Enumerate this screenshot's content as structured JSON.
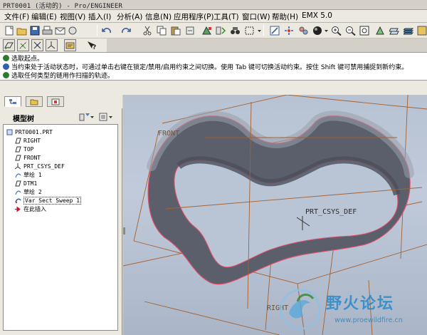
{
  "window": {
    "title": "PRT0001 (活动的) - Pro/ENGINEER"
  },
  "menu": [
    "文件(F)",
    "编辑(E)",
    "视图(V)",
    "插入(I)",
    "分析(A)",
    "信息(N)",
    "应用程序(P)",
    "工具(T)",
    "窗口(W)",
    "帮助(H)",
    "EMX 5.0"
  ],
  "toolbar": {
    "icons": [
      "new-icon",
      "open-icon",
      "save-icon",
      "print-icon",
      "email-icon",
      "undo-icon",
      "redo-icon",
      "cut-icon",
      "copy-icon",
      "paste-icon",
      "regenerate-icon",
      "find-icon",
      "select-box-icon",
      "repaint-icon",
      "spin-center-icon",
      "view-manager-icon",
      "shading-icon",
      "zoom-in-icon",
      "zoom-out-icon",
      "refit-icon",
      "orient-icon",
      "saved-views-icon",
      "layers-icon"
    ],
    "row2_icons": [
      "datum-plane-display-icon",
      "datum-axis-display-icon",
      "point-display-icon",
      "csys-display-icon",
      "annotation-display-icon",
      "context-help-icon"
    ]
  },
  "messages": [
    {
      "icon": "prompt",
      "text": "选取起点。"
    },
    {
      "icon": "info",
      "text": "当约束处于活动状态时，可通过单击右键在锁定/禁用/启用约束之间切换。使用 Tab 键可切换活动约束。按住 Shift 键可禁用捕捉到新约束。"
    },
    {
      "icon": "prompt",
      "text": "选取任何类型的链用作扫描的轨迹。"
    }
  ],
  "left_tabs": [
    "model-tree-tab",
    "folder-browser-tab",
    "favorites-tab"
  ],
  "model_tree": {
    "title": "模型树",
    "items": [
      {
        "label": "PRT0001.PRT",
        "icon": "part-icon",
        "indent": 0
      },
      {
        "label": "RIGHT",
        "icon": "datum-plane-icon",
        "indent": 1
      },
      {
        "label": "TOP",
        "icon": "datum-plane-icon",
        "indent": 1
      },
      {
        "label": "FRONT",
        "icon": "datum-plane-icon",
        "indent": 1
      },
      {
        "label": "PRT_CSYS_DEF",
        "icon": "csys-icon",
        "indent": 1
      },
      {
        "label": "草绘 1",
        "icon": "sketch-icon",
        "indent": 1
      },
      {
        "label": "DTM1",
        "icon": "datum-plane-icon",
        "indent": 1
      },
      {
        "label": "草绘 2",
        "icon": "sketch-icon",
        "indent": 1
      },
      {
        "label": "Var Sect Sweep 1",
        "icon": "sweep-icon",
        "indent": 1,
        "selected": true
      },
      {
        "label": "在此插入",
        "icon": "insert-here-icon",
        "indent": 1
      }
    ]
  },
  "viewport": {
    "labels": {
      "front": "FRONT",
      "csys": "PRT_CSYS_DEF",
      "bottom": "RIGHT"
    }
  },
  "watermark": {
    "title": "野火论坛",
    "url": "www.proewildfire.cn"
  },
  "colors": {
    "accent": "#2f5fb3",
    "surface": "#4f5461",
    "edge": "#e04d6a",
    "datum": "#a7612e"
  }
}
